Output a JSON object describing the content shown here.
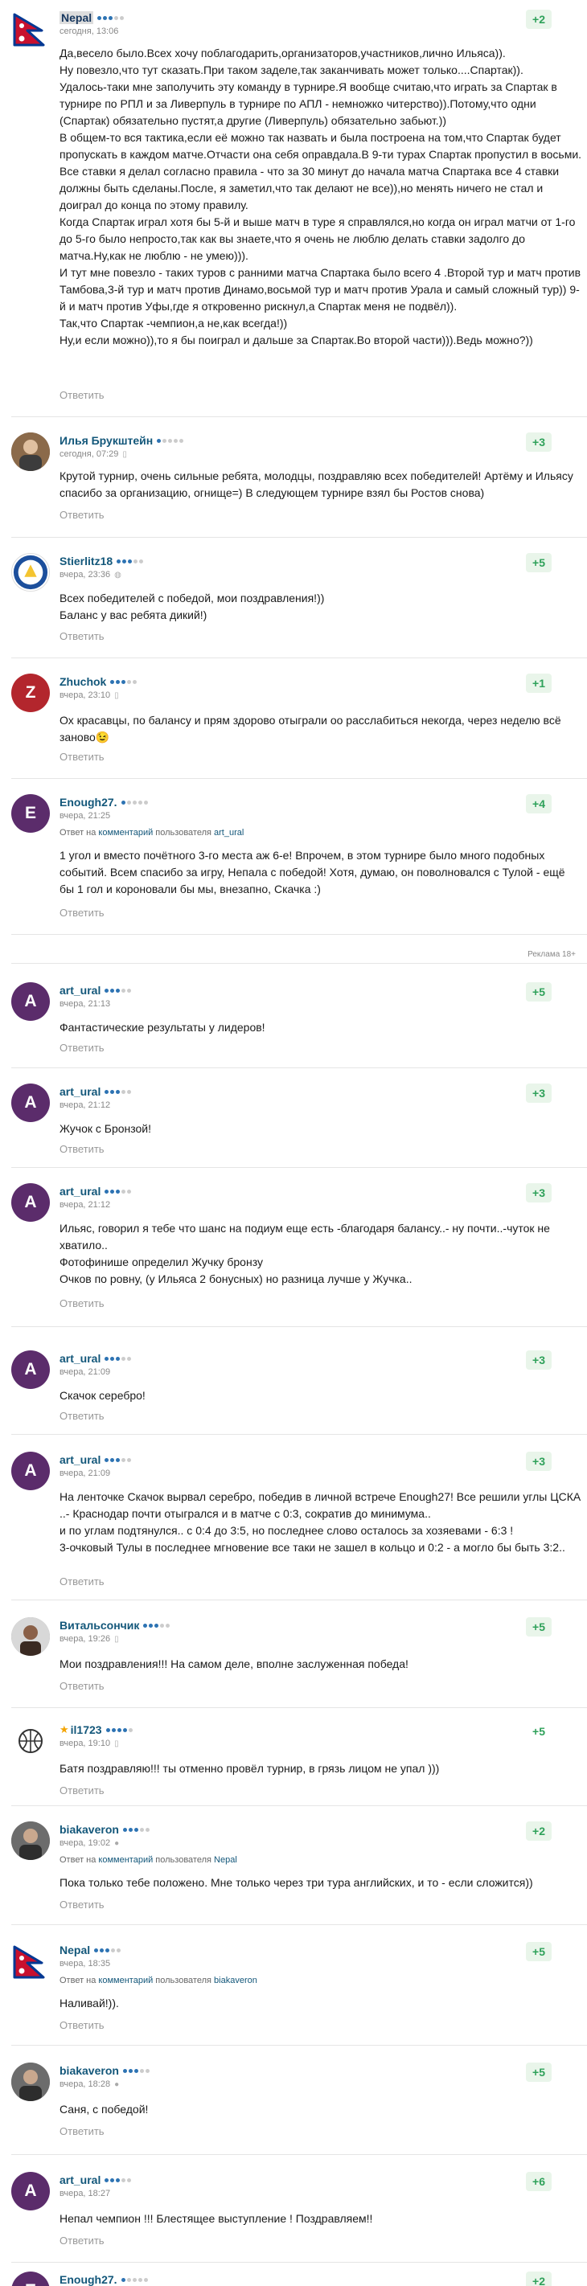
{
  "reply_label": "Ответить",
  "reply_prefix": "Ответ на",
  "reply_link": "комментарий",
  "reply_mid": "пользователя",
  "ad_label": "Реклама 18+",
  "comments": [
    {
      "author": "Nepal",
      "time": "сегодня, 13:06",
      "score": "+2",
      "dots": 3,
      "text": "Да,весело было.Всех хочу поблагодарить,организаторов,участников,лично Ильяса)).\nНу повезло,что тут сказать.При таком заделе,так заканчивать может только....Спартак)).\nУдалось-таки мне заполучить эту команду в турнире.Я вообще считаю,что играть за Спартак в турнире по РПЛ и за Ливерпуль в турнире по АПЛ - немножко читерство)).Потому,что одни (Спартак) обязательно пустят,а другие (Ливерпуль) обязательно забьют.))\nВ общем-то вся тактика,если её можно так назвать и была построена на том,что Спартак будет пропускать в каждом матче.Отчасти она себя оправдала.В 9-ти турах Спартак пропустил в восьми.\nВсе ставки я делал согласно правила - что за 30 минут до начала матча Спартака все 4 ставки должны быть сделаны.После, я заметил,что так делают не все)),но менять ничего не стал и доиграл до конца по этому правилу.\nКогда Спартак играл хотя бы 5-й и выше матч в туре я справлялся,но когда он играл матчи от 1-го до 5-го было непросто,так как вы знаете,что я очень не люблю делать ставки задолго до матча.Ну,как не люблю - не умею))).\nИ тут мне повезло - таких туров с ранними матча Спартака было всего 4 .Второй тур и матч против Тамбова,3-й тур и матч против Динамо,восьмой тур и матч против Урала и самый сложный тур)) 9-й и матч против Уфы,где я откровенно рискнул,а Спартак меня не подвёл)).\nТак,что Спартак -чемпион,а не,как всегда!))\nНу,и если можно)),то я бы поиграл и дальше за Спартак.Во второй части))).Ведь можно?))"
    },
    {
      "author": "Илья Брукштейн",
      "time": "сегодня, 07:29",
      "score": "+3",
      "dots": 1,
      "text": "Крутой турнир, очень сильные ребята, молодцы, поздравляю всех победителей! Артёму и Ильясу спасибо за организацию, огнище=) В следующем турнире взял бы Ростов снова)"
    },
    {
      "author": "Stierlitz18",
      "time": "вчера, 23:36",
      "score": "+5",
      "dots": 3,
      "text": "Всех победителей с победой, мои поздравления!))\nБаланс у вас ребята дикий!)"
    },
    {
      "author": "Zhuchok",
      "time": "вчера, 23:10",
      "score": "+1",
      "dots": 3,
      "text": "Ох красавцы, по балансу и прям здорово отыграли оо расслабиться некогда, через неделю всё заново😉"
    },
    {
      "author": "Enough27.",
      "time": "вчера, 21:25",
      "score": "+4",
      "dots": 1,
      "reply_to": "art_ural",
      "text": "1 угол и вместо почётного 3-го места аж 6-е! Впрочем, в этом турнире было много подобных событий. Всем спасибо за игру, Непала с победой! Хотя, думаю, он поволновался с Тулой - ещё бы 1 гол и короновали бы мы, внезапно, Скачка :)"
    },
    {
      "author": "art_ural",
      "time": "вчера, 21:13",
      "score": "+5",
      "dots": 3,
      "text": "Фантастические результаты у лидеров!"
    },
    {
      "author": "art_ural",
      "time": "вчера, 21:12",
      "score": "+3",
      "dots": 3,
      "text": "Жучок с Бронзой!"
    },
    {
      "author": "art_ural",
      "time": "вчера, 21:12",
      "score": "+3",
      "dots": 3,
      "text": "Ильяс, говорил я тебе что шанс на подиум еще есть -благодаря балансу..- ну почти..-чуток не хватило..\nФотофинише определил Жучку бронзу\nОчков по ровну, (у Ильяса 2 бонусных) но разница лучше у Жучка.."
    },
    {
      "author": "art_ural",
      "time": "вчера, 21:09",
      "score": "+3",
      "dots": 3,
      "text": "Скачок серебро!"
    },
    {
      "author": "art_ural",
      "time": "вчера, 21:09",
      "score": "+3",
      "dots": 3,
      "text": "На ленточке Скачок вырвал серебро, победив в личной встрече Enough27! Все решили углы ЦСКА ..- Краснодар почти отыгрался и в матче с 0:3, сократив до минимума..\nи по углам подтянулся.. с 0:4 до 3:5, но последнее слово осталось за хозяевами - 6:3 !\n3-очковый Тулы в последнее мгновение все таки не зашел в кольцо и 0:2 - а могло бы быть 3:2.."
    },
    {
      "author": "Витальсончик",
      "time": "вчера, 19:26",
      "score": "+5",
      "dots": 3,
      "text": "Мои поздравления!!! На самом деле, вполне заслуженная победа!"
    },
    {
      "author": "il1723",
      "time": "вчера, 19:10",
      "score": "+5",
      "dots": 4,
      "text": "Батя поздравляю!!! ты отменно провёл турнир, в грязь лицом не упал )))"
    },
    {
      "author": "biakaveron",
      "time": "вчера, 19:02",
      "score": "+2",
      "dots": 3,
      "reply_to": "Nepal",
      "text": "Пока только тебе положено. Мне только через три тура английских, и то - если сложится))"
    },
    {
      "author": "Nepal",
      "time": "вчера, 18:35",
      "score": "+5",
      "dots": 3,
      "reply_to": "biakaveron",
      "text": "Наливай!))."
    },
    {
      "author": "biakaveron",
      "time": "вчера, 18:28",
      "score": "+5",
      "dots": 3,
      "text": "Саня, с победой!"
    },
    {
      "author": "art_ural",
      "time": "вчера, 18:27",
      "score": "+6",
      "dots": 3,
      "text": "Непал чемпион !!! Блестящее выступление ! Поздравляем!!"
    },
    {
      "author": "Enough27.",
      "time": "вчера, 18:06",
      "score": "+2",
      "dots": 1,
      "text": ""
    }
  ]
}
